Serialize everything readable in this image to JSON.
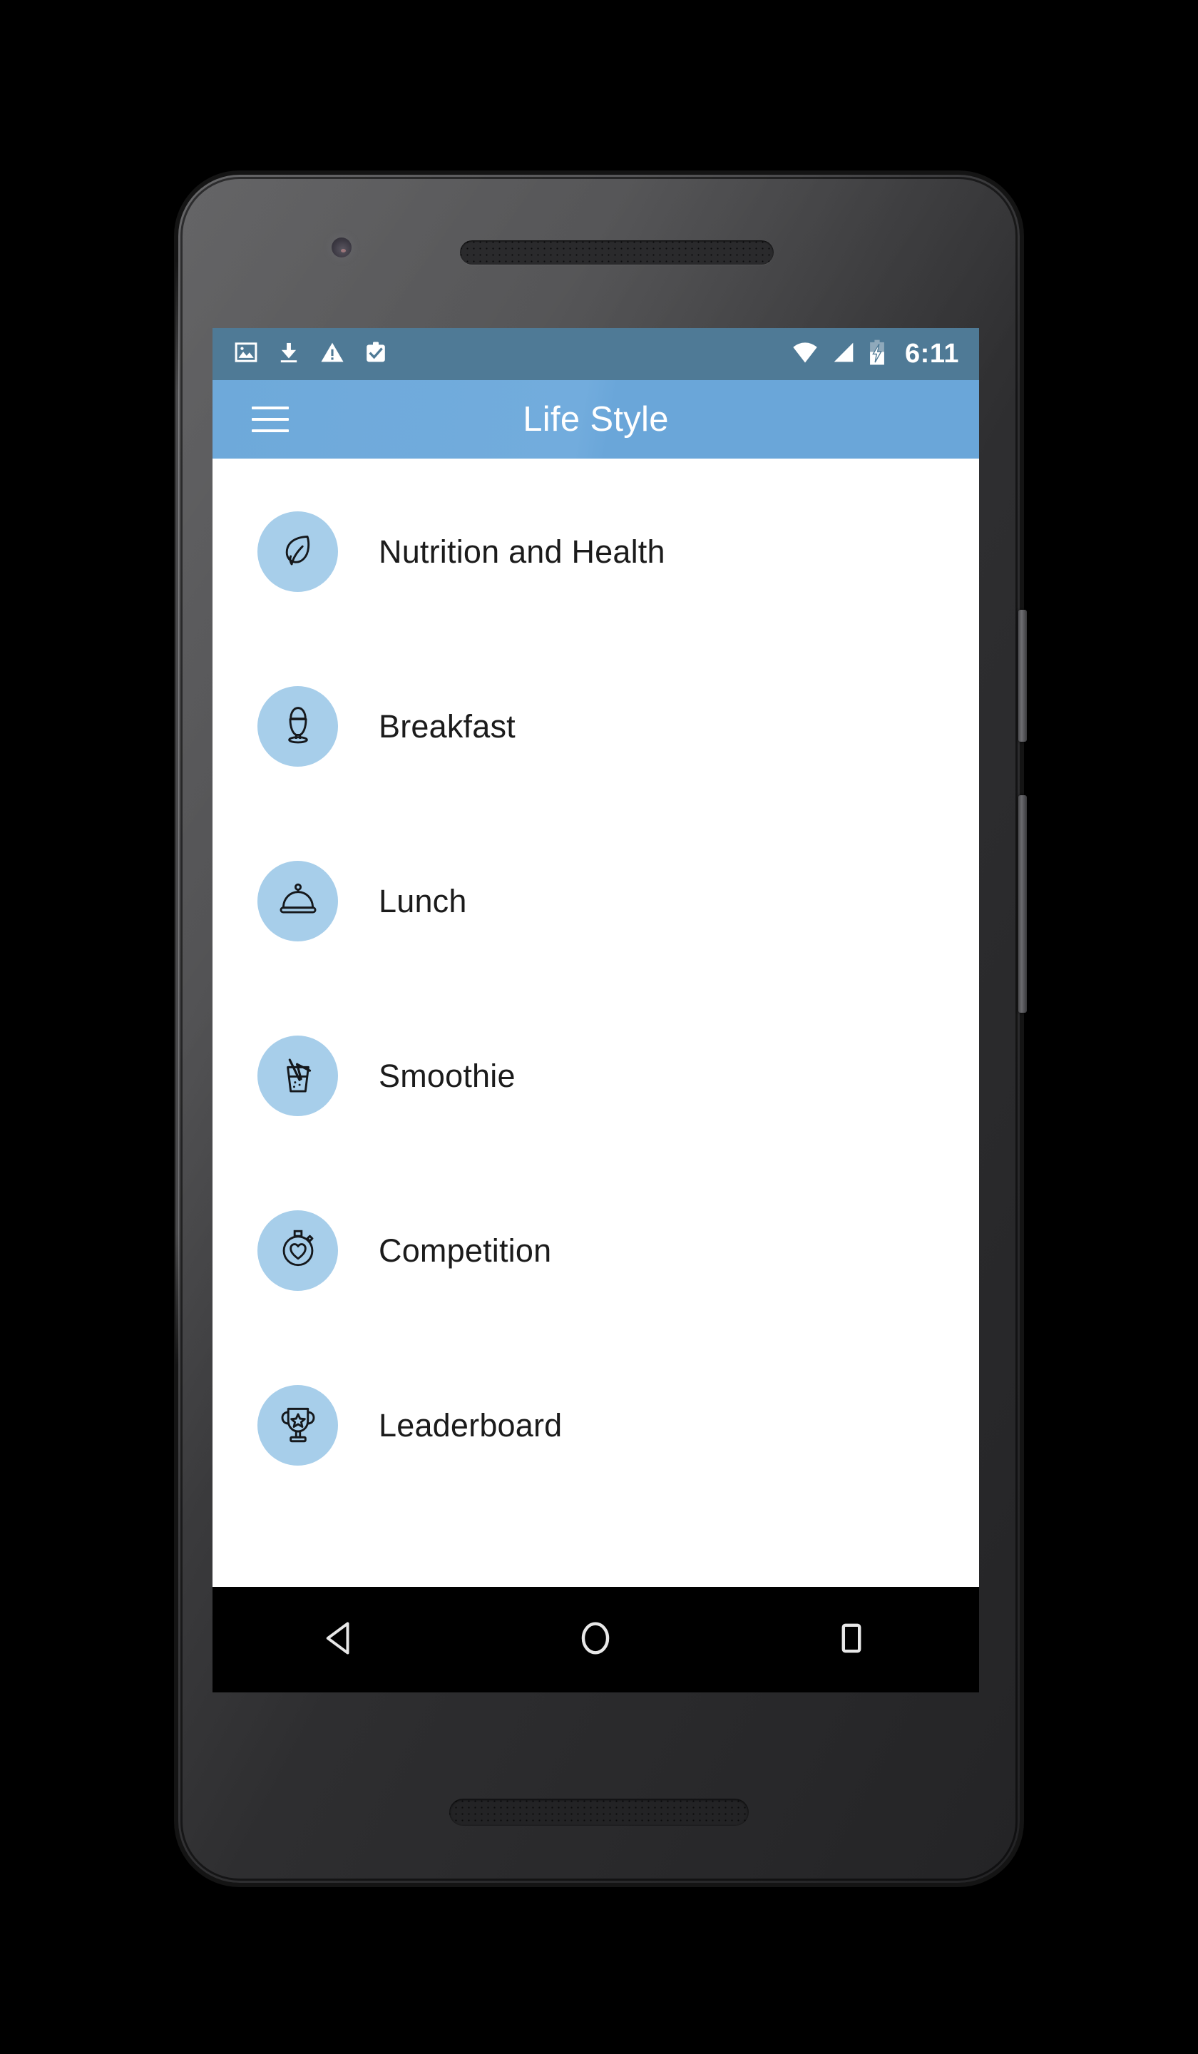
{
  "device": {
    "type": "android-phone-mockup",
    "frame_color": "#3a3a3c"
  },
  "statusbar": {
    "background_color": "#4f7a96",
    "time": "6:11",
    "left_icons": [
      {
        "name": "image-icon",
        "label": "Screenshot / image"
      },
      {
        "name": "download-icon",
        "label": "Download"
      },
      {
        "name": "warning-icon",
        "label": "Warning"
      },
      {
        "name": "clipboard-check-icon",
        "label": "Clipboard check"
      }
    ],
    "right_icons": [
      {
        "name": "wifi-icon",
        "label": "Wi-Fi"
      },
      {
        "name": "cell-signal-icon",
        "label": "Cellular signal"
      },
      {
        "name": "battery-charging-icon",
        "label": "Battery charging"
      }
    ]
  },
  "appbar": {
    "title": "Life Style",
    "background_color": "#6ea9da",
    "text_color": "#ffffff",
    "menu_icon": "hamburger-menu-icon"
  },
  "list": {
    "avatar_color": "#a7ceea",
    "text_color": "#1b1b1b",
    "items": [
      {
        "label": "Nutrition and Health",
        "icon": "leaf-icon"
      },
      {
        "label": "Breakfast",
        "icon": "egg-cup-icon"
      },
      {
        "label": "Lunch",
        "icon": "cloche-icon"
      },
      {
        "label": "Smoothie",
        "icon": "smoothie-glass-icon"
      },
      {
        "label": "Competition",
        "icon": "stopwatch-heart-icon"
      },
      {
        "label": "Leaderboard",
        "icon": "trophy-star-icon"
      }
    ]
  },
  "navbar": {
    "background_color": "#000000",
    "buttons": [
      {
        "name": "back-button",
        "icon": "triangle-back-icon"
      },
      {
        "name": "home-button",
        "icon": "circle-home-icon"
      },
      {
        "name": "recents-button",
        "icon": "square-recents-icon"
      }
    ]
  }
}
